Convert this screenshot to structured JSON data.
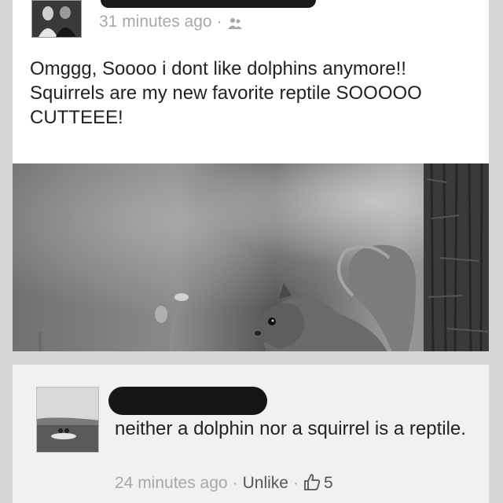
{
  "post": {
    "author_redacted": true,
    "timestamp": "31 minutes ago",
    "separator": "·",
    "audience_icon": "friends-icon",
    "text": "Omggg, Soooo i dont like dolphins anymore!!  Squirrels are my new favorite reptile SOOOOO CUTTEEE!",
    "photo": "squirrel-photo"
  },
  "comment": {
    "author_redacted": true,
    "text": "neither a dolphin nor a squirrel is a reptile.",
    "timestamp": "24 minutes ago",
    "separator": "·",
    "unlike_label": "Unlike",
    "like_icon": "thumbs-up-icon",
    "like_count": "5"
  }
}
